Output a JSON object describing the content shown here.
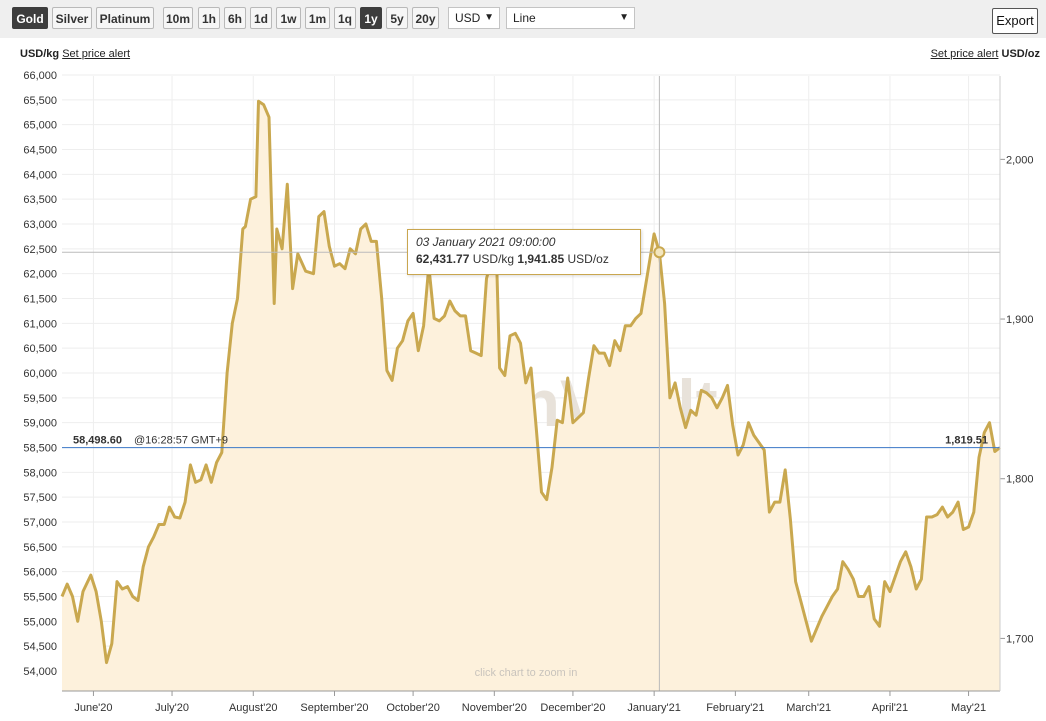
{
  "toolbar": {
    "metals": [
      {
        "label": "Gold",
        "active": true
      },
      {
        "label": "Silver",
        "active": false
      },
      {
        "label": "Platinum",
        "active": false
      }
    ],
    "ranges": [
      {
        "label": "10m",
        "active": false
      },
      {
        "label": "1h",
        "active": false
      },
      {
        "label": "6h",
        "active": false
      },
      {
        "label": "1d",
        "active": false
      },
      {
        "label": "1w",
        "active": false
      },
      {
        "label": "1m",
        "active": false
      },
      {
        "label": "1q",
        "active": false
      },
      {
        "label": "1y",
        "active": true
      },
      {
        "label": "5y",
        "active": false
      },
      {
        "label": "20y",
        "active": false
      }
    ],
    "currency": "USD",
    "chart_style": "Line",
    "export_label": "Export"
  },
  "left_unit": "USD/kg",
  "right_unit": "USD/oz",
  "alert_link": "Set price alert",
  "watermark": "BullionVault",
  "zoom_hint": "click chart to zoom in",
  "current": {
    "left_label": "58,498.60",
    "time_label": "@16:28:57 GMT+9",
    "right_label": "1,819.51",
    "value_kg": 58498.6
  },
  "tooltip": {
    "date": "03 January 2021 09:00:00",
    "kg_value": "62,431.77",
    "kg_unit": "USD/kg",
    "oz_value": "1,941.85",
    "oz_unit": "USD/oz",
    "x": "2021-01-03",
    "y": 62431.77
  },
  "colors": {
    "line": "#c9a84f",
    "fill": "#fdf1dc",
    "current_line": "#3c78c8",
    "current_text": "#2b66b8"
  },
  "chart_data": {
    "type": "area",
    "y_left": {
      "min": 53700,
      "max": 66000,
      "ticks": [
        54000,
        54500,
        55000,
        55500,
        56000,
        56500,
        57000,
        57500,
        58000,
        58500,
        59000,
        59500,
        60000,
        60500,
        61000,
        61500,
        62000,
        62500,
        63000,
        63500,
        64000,
        64500,
        65000,
        65500,
        66000
      ]
    },
    "y_right": {
      "ticks": [
        1700,
        1800,
        1900,
        2000
      ],
      "tick_labels": [
        "1,700",
        "1,800",
        "1,900",
        "2,000"
      ]
    },
    "x_range": [
      "2020-05-20",
      "2021-05-13"
    ],
    "x_ticks": [
      {
        "date": "2020-06-01",
        "label": "June'20"
      },
      {
        "date": "2020-07-01",
        "label": "July'20"
      },
      {
        "date": "2020-08-01",
        "label": "August'20"
      },
      {
        "date": "2020-09-01",
        "label": "September'20"
      },
      {
        "date": "2020-10-01",
        "label": "October'20"
      },
      {
        "date": "2020-11-01",
        "label": "November'20"
      },
      {
        "date": "2020-12-01",
        "label": "December'20"
      },
      {
        "date": "2021-01-01",
        "label": "January'21"
      },
      {
        "date": "2021-02-01",
        "label": "February'21"
      },
      {
        "date": "2021-03-01",
        "label": "March'21"
      },
      {
        "date": "2021-04-01",
        "label": "April'21"
      },
      {
        "date": "2021-05-01",
        "label": "May'21"
      }
    ],
    "series": [
      {
        "values": [
          [
            "2020-05-20",
            55500
          ],
          [
            "2020-05-22",
            55750
          ],
          [
            "2020-05-24",
            55500
          ],
          [
            "2020-05-26",
            55000
          ],
          [
            "2020-05-28",
            55600
          ],
          [
            "2020-05-31",
            55930
          ],
          [
            "2020-06-02",
            55600
          ],
          [
            "2020-06-04",
            55000
          ],
          [
            "2020-06-06",
            54170
          ],
          [
            "2020-06-08",
            54550
          ],
          [
            "2020-06-10",
            55800
          ],
          [
            "2020-06-12",
            55650
          ],
          [
            "2020-06-14",
            55700
          ],
          [
            "2020-06-16",
            55500
          ],
          [
            "2020-06-18",
            55420
          ],
          [
            "2020-06-20",
            56100
          ],
          [
            "2020-06-22",
            56500
          ],
          [
            "2020-06-24",
            56700
          ],
          [
            "2020-06-26",
            56950
          ],
          [
            "2020-06-28",
            56950
          ],
          [
            "2020-06-30",
            57300
          ],
          [
            "2020-07-02",
            57100
          ],
          [
            "2020-07-04",
            57080
          ],
          [
            "2020-07-06",
            57400
          ],
          [
            "2020-07-08",
            58150
          ],
          [
            "2020-07-10",
            57800
          ],
          [
            "2020-07-12",
            57850
          ],
          [
            "2020-07-14",
            58150
          ],
          [
            "2020-07-16",
            57800
          ],
          [
            "2020-07-18",
            58200
          ],
          [
            "2020-07-20",
            58400
          ],
          [
            "2020-07-22",
            60000
          ],
          [
            "2020-07-24",
            61000
          ],
          [
            "2020-07-26",
            61500
          ],
          [
            "2020-07-28",
            62900
          ],
          [
            "2020-07-29",
            62950
          ],
          [
            "2020-07-31",
            63500
          ],
          [
            "2020-08-02",
            63550
          ],
          [
            "2020-08-03",
            65470
          ],
          [
            "2020-08-05",
            65400
          ],
          [
            "2020-08-07",
            65150
          ],
          [
            "2020-08-09",
            61400
          ],
          [
            "2020-08-10",
            62900
          ],
          [
            "2020-08-12",
            62500
          ],
          [
            "2020-08-14",
            63800
          ],
          [
            "2020-08-16",
            61700
          ],
          [
            "2020-08-18",
            62400
          ],
          [
            "2020-08-21",
            62050
          ],
          [
            "2020-08-24",
            62000
          ],
          [
            "2020-08-26",
            63150
          ],
          [
            "2020-08-28",
            63250
          ],
          [
            "2020-08-30",
            62550
          ],
          [
            "2020-09-01",
            62150
          ],
          [
            "2020-09-03",
            62200
          ],
          [
            "2020-09-05",
            62100
          ],
          [
            "2020-09-07",
            62500
          ],
          [
            "2020-09-09",
            62400
          ],
          [
            "2020-09-11",
            62900
          ],
          [
            "2020-09-13",
            63000
          ],
          [
            "2020-09-15",
            62650
          ],
          [
            "2020-09-17",
            62650
          ],
          [
            "2020-09-19",
            61500
          ],
          [
            "2020-09-21",
            60050
          ],
          [
            "2020-09-23",
            59850
          ],
          [
            "2020-09-25",
            60500
          ],
          [
            "2020-09-27",
            60650
          ],
          [
            "2020-09-29",
            61050
          ],
          [
            "2020-10-01",
            61200
          ],
          [
            "2020-10-03",
            60450
          ],
          [
            "2020-10-05",
            60950
          ],
          [
            "2020-10-07",
            62150
          ],
          [
            "2020-10-09",
            61100
          ],
          [
            "2020-10-11",
            61050
          ],
          [
            "2020-10-13",
            61150
          ],
          [
            "2020-10-15",
            61450
          ],
          [
            "2020-10-17",
            61250
          ],
          [
            "2020-10-19",
            61150
          ],
          [
            "2020-10-21",
            61150
          ],
          [
            "2020-10-23",
            60450
          ],
          [
            "2020-10-25",
            60400
          ],
          [
            "2020-10-27",
            60350
          ],
          [
            "2020-10-29",
            61900
          ],
          [
            "2020-10-31",
            62300
          ],
          [
            "2020-11-02",
            62050
          ],
          [
            "2020-11-03",
            60100
          ],
          [
            "2020-11-05",
            59950
          ],
          [
            "2020-11-07",
            60750
          ],
          [
            "2020-11-09",
            60800
          ],
          [
            "2020-11-11",
            60600
          ],
          [
            "2020-11-13",
            59800
          ],
          [
            "2020-11-15",
            60100
          ],
          [
            "2020-11-17",
            58900
          ],
          [
            "2020-11-19",
            57600
          ],
          [
            "2020-11-21",
            57450
          ],
          [
            "2020-11-23",
            58100
          ],
          [
            "2020-11-25",
            59050
          ],
          [
            "2020-11-27",
            59000
          ],
          [
            "2020-11-29",
            59900
          ],
          [
            "2020-12-01",
            59000
          ],
          [
            "2020-12-03",
            59100
          ],
          [
            "2020-12-05",
            59200
          ],
          [
            "2020-12-07",
            59900
          ],
          [
            "2020-12-09",
            60550
          ],
          [
            "2020-12-11",
            60400
          ],
          [
            "2020-12-13",
            60400
          ],
          [
            "2020-12-15",
            60150
          ],
          [
            "2020-12-17",
            60650
          ],
          [
            "2020-12-19",
            60450
          ],
          [
            "2020-12-21",
            60950
          ],
          [
            "2020-12-23",
            60950
          ],
          [
            "2020-12-25",
            61100
          ],
          [
            "2020-12-27",
            61200
          ],
          [
            "2021-01-01",
            62800
          ],
          [
            "2021-01-03",
            62431
          ],
          [
            "2021-01-05",
            61400
          ],
          [
            "2021-01-07",
            59500
          ],
          [
            "2021-01-09",
            59800
          ],
          [
            "2021-01-11",
            59300
          ],
          [
            "2021-01-13",
            58900
          ],
          [
            "2021-01-15",
            59250
          ],
          [
            "2021-01-17",
            59150
          ],
          [
            "2021-01-19",
            59650
          ],
          [
            "2021-01-21",
            59600
          ],
          [
            "2021-01-23",
            59500
          ],
          [
            "2021-01-25",
            59300
          ],
          [
            "2021-01-27",
            59500
          ],
          [
            "2021-01-29",
            59750
          ],
          [
            "2021-01-31",
            58950
          ],
          [
            "2021-02-02",
            58350
          ],
          [
            "2021-02-04",
            58550
          ],
          [
            "2021-02-06",
            59000
          ],
          [
            "2021-02-08",
            58750
          ],
          [
            "2021-02-10",
            58600
          ],
          [
            "2021-02-12",
            58450
          ],
          [
            "2021-02-14",
            57200
          ],
          [
            "2021-02-16",
            57400
          ],
          [
            "2021-02-18",
            57400
          ],
          [
            "2021-02-20",
            58050
          ],
          [
            "2021-02-22",
            57050
          ],
          [
            "2021-02-24",
            55800
          ],
          [
            "2021-02-26",
            55400
          ],
          [
            "2021-02-28",
            55000
          ],
          [
            "2021-03-02",
            54600
          ],
          [
            "2021-03-04",
            54850
          ],
          [
            "2021-03-06",
            55100
          ],
          [
            "2021-03-08",
            55300
          ],
          [
            "2021-03-10",
            55500
          ],
          [
            "2021-03-12",
            55650
          ],
          [
            "2021-03-14",
            56200
          ],
          [
            "2021-03-16",
            56050
          ],
          [
            "2021-03-18",
            55850
          ],
          [
            "2021-03-20",
            55500
          ],
          [
            "2021-03-22",
            55500
          ],
          [
            "2021-03-24",
            55700
          ],
          [
            "2021-03-26",
            55050
          ],
          [
            "2021-03-28",
            54900
          ],
          [
            "2021-03-30",
            55800
          ],
          [
            "2021-04-01",
            55600
          ],
          [
            "2021-04-03",
            55900
          ],
          [
            "2021-04-05",
            56200
          ],
          [
            "2021-04-07",
            56400
          ],
          [
            "2021-04-09",
            56100
          ],
          [
            "2021-04-11",
            55650
          ],
          [
            "2021-04-13",
            55850
          ],
          [
            "2021-04-15",
            57100
          ],
          [
            "2021-04-17",
            57100
          ],
          [
            "2021-04-19",
            57150
          ],
          [
            "2021-04-21",
            57300
          ],
          [
            "2021-04-23",
            57100
          ],
          [
            "2021-04-25",
            57200
          ],
          [
            "2021-04-27",
            57400
          ],
          [
            "2021-04-29",
            56850
          ],
          [
            "2021-05-01",
            56900
          ],
          [
            "2021-05-03",
            57200
          ],
          [
            "2021-05-05",
            58300
          ],
          [
            "2021-05-07",
            58800
          ],
          [
            "2021-05-09",
            59000
          ],
          [
            "2021-05-11",
            58420
          ],
          [
            "2021-05-13",
            58498
          ]
        ]
      }
    ]
  }
}
